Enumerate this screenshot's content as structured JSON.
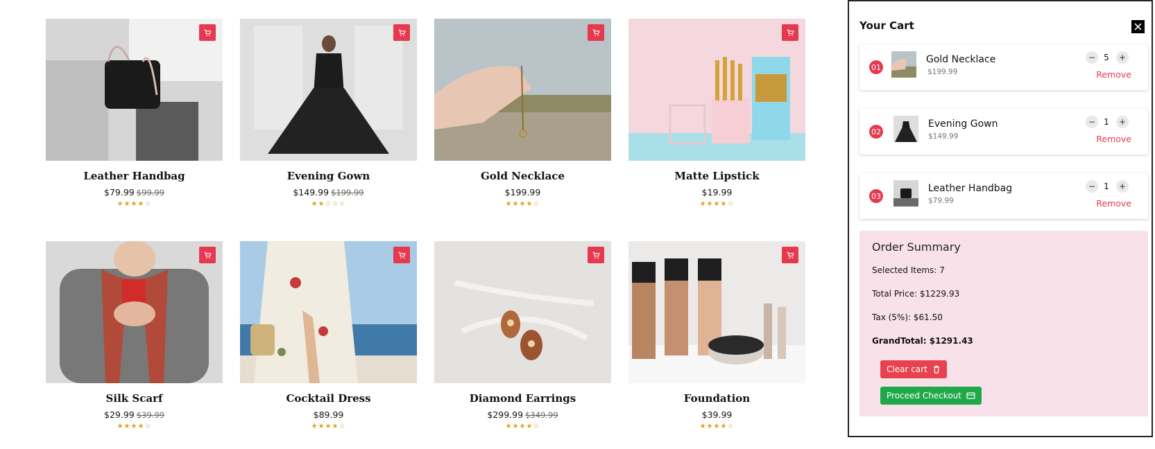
{
  "products": [
    {
      "name": "Leather Handbag",
      "price": "$79.99",
      "old_price": "$99.99",
      "rating": 4
    },
    {
      "name": "Evening Gown",
      "price": "$149.99",
      "old_price": "$199.99",
      "rating": 2
    },
    {
      "name": "Gold Necklace",
      "price": "$199.99",
      "old_price": "",
      "rating": 4
    },
    {
      "name": "Matte Lipstick",
      "price": "$19.99",
      "old_price": "",
      "rating": 4
    },
    {
      "name": "Silk Scarf",
      "price": "$29.99",
      "old_price": "$39.99",
      "rating": 4
    },
    {
      "name": "Cocktail Dress",
      "price": "$89.99",
      "old_price": "",
      "rating": 4
    },
    {
      "name": "Diamond Earrings",
      "price": "$299.99",
      "old_price": "$349.99",
      "rating": 4
    },
    {
      "name": "Foundation",
      "price": "$39.99",
      "old_price": "",
      "rating": 4
    }
  ],
  "cart": {
    "title": "Your Cart",
    "items": [
      {
        "index": "01",
        "name": "Gold Necklace",
        "price": "$199.99",
        "qty": "5",
        "remove": "Remove"
      },
      {
        "index": "02",
        "name": "Evening Gown",
        "price": "$149.99",
        "qty": "1",
        "remove": "Remove"
      },
      {
        "index": "03",
        "name": "Leather Handbag",
        "price": "$79.99",
        "qty": "1",
        "remove": "Remove"
      }
    ],
    "summary": {
      "title": "Order Summary",
      "selected": "Selected Items: 7",
      "total": "Total Price: $1229.93",
      "tax": "Tax (5%): $61.50",
      "grand": "GrandTotal: $1291.43",
      "clear_label": "Clear cart",
      "checkout_label": "Proceed Checkout"
    }
  },
  "colors": {
    "accent": "#e63950",
    "success": "#1fa84a",
    "summary_bg": "#f8e1e8",
    "star": "#d9a520"
  }
}
